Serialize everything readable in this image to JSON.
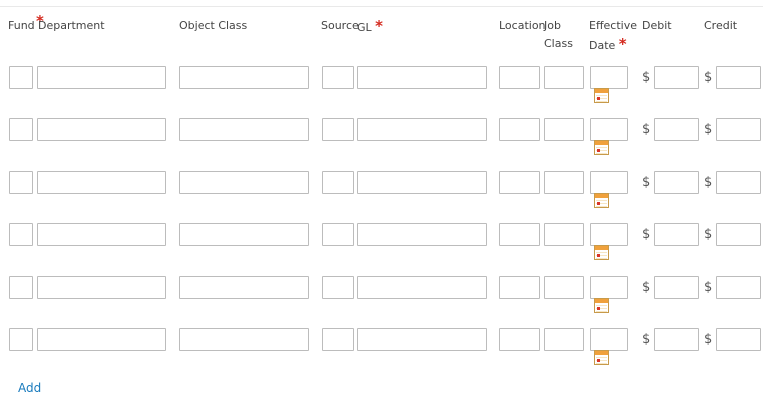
{
  "headers": {
    "fund": "Fund",
    "department": "Department",
    "object_class": "Object Class",
    "source": "Source",
    "gl": "GL",
    "location": "Location",
    "job": "Job",
    "class": "Class",
    "effective": "Effective",
    "date": "Date",
    "debit": "Debit",
    "credit": "Credit",
    "required_mark": "*"
  },
  "currency_symbol": "$",
  "rows": [
    {
      "fund": "",
      "department": "",
      "object_class": "",
      "source": "",
      "gl": "",
      "location": "",
      "job_class": "",
      "effective_date": "",
      "debit": "",
      "credit": ""
    },
    {
      "fund": "",
      "department": "",
      "object_class": "",
      "source": "",
      "gl": "",
      "location": "",
      "job_class": "",
      "effective_date": "",
      "debit": "",
      "credit": ""
    },
    {
      "fund": "",
      "department": "",
      "object_class": "",
      "source": "",
      "gl": "",
      "location": "",
      "job_class": "",
      "effective_date": "",
      "debit": "",
      "credit": ""
    },
    {
      "fund": "",
      "department": "",
      "object_class": "",
      "source": "",
      "gl": "",
      "location": "",
      "job_class": "",
      "effective_date": "",
      "debit": "",
      "credit": ""
    },
    {
      "fund": "",
      "department": "",
      "object_class": "",
      "source": "",
      "gl": "",
      "location": "",
      "job_class": "",
      "effective_date": "",
      "debit": "",
      "credit": ""
    },
    {
      "fund": "",
      "department": "",
      "object_class": "",
      "source": "",
      "gl": "",
      "location": "",
      "job_class": "",
      "effective_date": "",
      "debit": "",
      "credit": ""
    }
  ],
  "add_label": "Add",
  "colors": {
    "required": "#d42a1f",
    "link": "#1a7bbd",
    "border": "#bcbcbc"
  }
}
